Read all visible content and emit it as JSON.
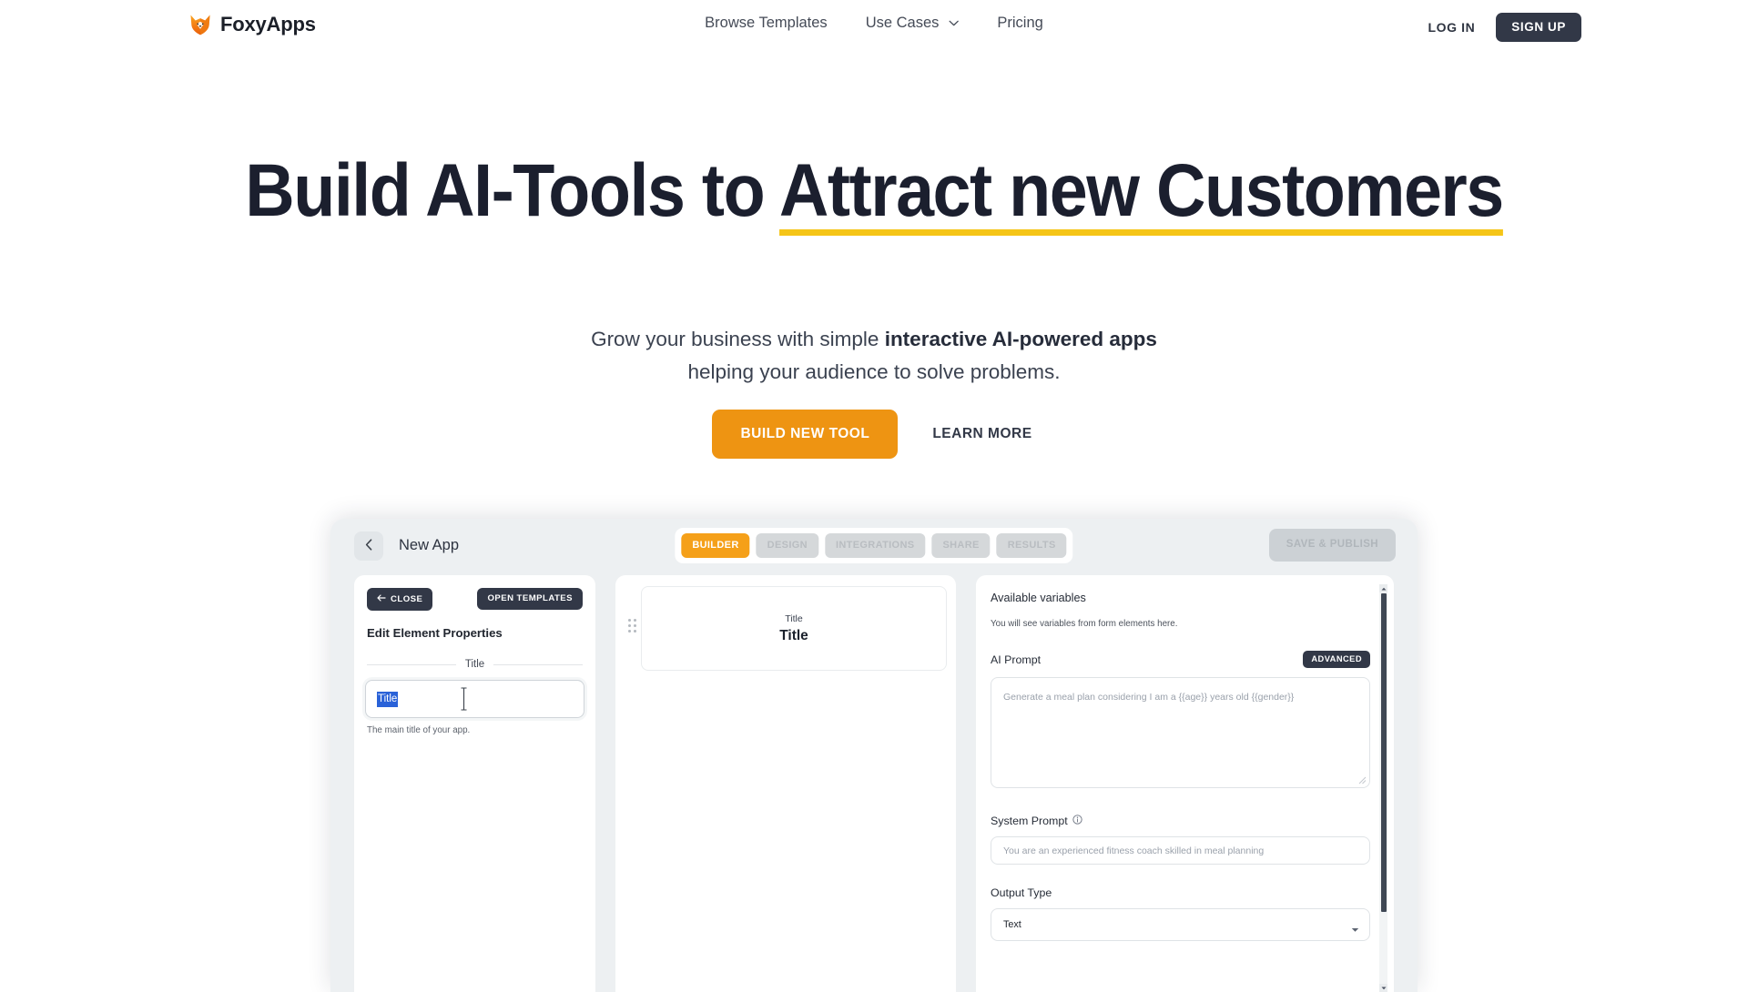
{
  "brand": {
    "name": "FoxyApps",
    "logo_icon": "fox-icon"
  },
  "nav": {
    "links": [
      {
        "label": "Browse Templates",
        "icon": null
      },
      {
        "label": "Use Cases",
        "icon": "chevron-down-icon"
      },
      {
        "label": "Pricing",
        "icon": null
      }
    ],
    "login_label": "LOG IN",
    "signup_label": "SIGN UP"
  },
  "hero": {
    "headline_part1": "Build AI-Tools to ",
    "headline_highlight": "Attract new Customers",
    "subhead_pre": "Grow your business with simple ",
    "subhead_bold": "interactive AI-powered apps",
    "subhead_post": "helping your audience to solve problems.",
    "cta_primary": "BUILD NEW TOOL",
    "cta_secondary": "LEARN MORE",
    "accent_orange": "#ee9412",
    "underline_yellow": "#f5c518"
  },
  "builder": {
    "back_icon": "chevron-left-icon",
    "app_title": "New App",
    "tabs": [
      {
        "label": "BUILDER",
        "active": true
      },
      {
        "label": "DESIGN",
        "active": false
      },
      {
        "label": "INTEGRATIONS",
        "active": false
      },
      {
        "label": "SHARE",
        "active": false
      },
      {
        "label": "RESULTS",
        "active": false
      }
    ],
    "save_label": "SAVE & PUBLISH",
    "left_panel": {
      "close_label": "CLOSE",
      "close_icon": "arrow-left-icon",
      "templates_label": "OPEN TEMPLATES",
      "heading": "Edit Element Properties",
      "field_legend": "Title",
      "title_value": "Title",
      "helper_text": "The main title of your app."
    },
    "center_panel": {
      "drag_icon": "drag-handle-icon",
      "card_label": "Title",
      "card_title": "Title"
    },
    "right_panel": {
      "variables_heading": "Available variables",
      "variables_hint": "You will see variables from form elements here.",
      "ai_prompt_label": "AI Prompt",
      "advanced_badge": "ADVANCED",
      "ai_prompt_placeholder": "Generate a meal plan considering I am a {{age}} years old {{gender}}",
      "system_prompt_label": "System Prompt",
      "system_prompt_info_icon": "info-icon",
      "system_prompt_placeholder": "You are an experienced fitness coach skilled in meal planning",
      "output_type_label": "Output Type",
      "output_type_value": "Text",
      "output_type_caret": "caret-down-icon"
    }
  }
}
